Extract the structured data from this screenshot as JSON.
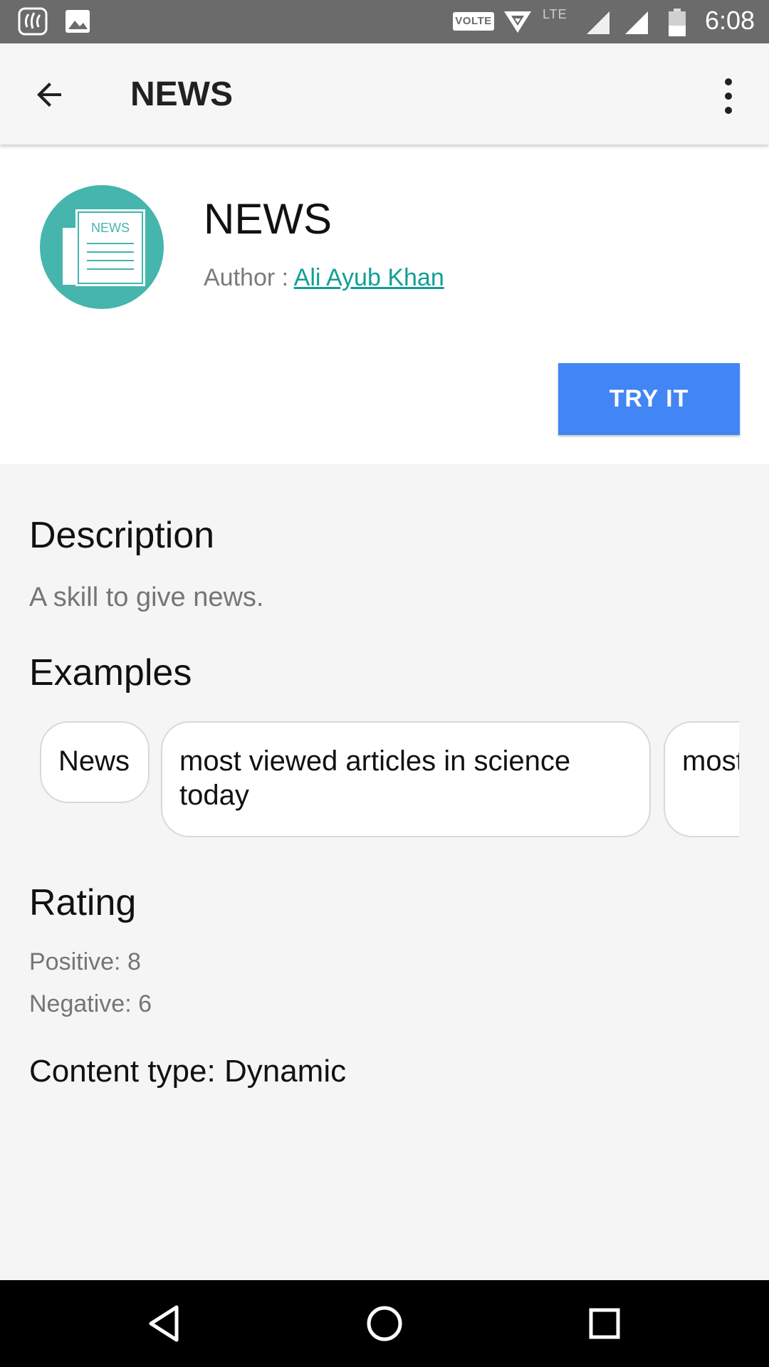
{
  "status_bar": {
    "time": "6:08",
    "volte": "VOLTE",
    "network": "LTE",
    "icons": [
      "saavn-icon",
      "gallery-icon",
      "hotspot-icon",
      "signal-icon",
      "signal-icon",
      "battery-icon"
    ]
  },
  "app_bar": {
    "title": "NEWS",
    "back_icon": "arrow-back-icon",
    "menu_icon": "more-vert-icon"
  },
  "skill": {
    "name": "NEWS",
    "icon_label": "NEWS",
    "author_label": "Author : ",
    "author_name": "Ali Ayub Khan",
    "try_button": "TRY IT",
    "accent_color": "#45b5ad",
    "button_color": "#4285f4"
  },
  "description": {
    "heading": "Description",
    "text": "A skill to give news."
  },
  "examples": {
    "heading": "Examples",
    "items": [
      "News",
      "most viewed articles in science today",
      "most the l"
    ]
  },
  "rating": {
    "heading": "Rating",
    "positive": "Positive: 8",
    "negative": "Negative: 6"
  },
  "content_type": "Content type: Dynamic",
  "nav_bar": {
    "icons": [
      "back-triangle-icon",
      "home-circle-icon",
      "recents-square-icon"
    ]
  }
}
